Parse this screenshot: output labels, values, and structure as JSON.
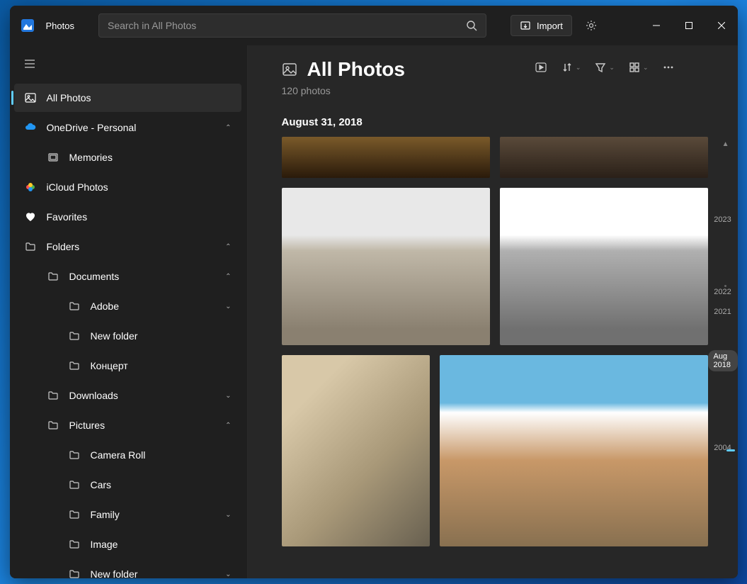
{
  "app": {
    "title": "Photos"
  },
  "search": {
    "placeholder": "Search in All Photos"
  },
  "titlebar": {
    "import_label": "Import"
  },
  "sidebar": {
    "items": [
      {
        "label": "All Photos",
        "icon": "image-icon",
        "active": true
      },
      {
        "label": "OneDrive - Personal",
        "icon": "cloud-icon",
        "expandable": "up"
      },
      {
        "label": "Memories",
        "icon": "memories-icon",
        "indent": 1
      },
      {
        "label": "iCloud Photos",
        "icon": "icloud-icon"
      },
      {
        "label": "Favorites",
        "icon": "heart-icon"
      },
      {
        "label": "Folders",
        "icon": "folder-icon",
        "expandable": "up"
      },
      {
        "label": "Documents",
        "icon": "folder-icon",
        "indent": 1,
        "expandable": "up"
      },
      {
        "label": "Adobe",
        "icon": "folder-icon",
        "indent": 2,
        "expandable": "down"
      },
      {
        "label": "New folder",
        "icon": "folder-icon",
        "indent": 2
      },
      {
        "label": "Концерт",
        "icon": "folder-icon",
        "indent": 2
      },
      {
        "label": "Downloads",
        "icon": "folder-icon",
        "indent": 1,
        "expandable": "down"
      },
      {
        "label": "Pictures",
        "icon": "folder-icon",
        "indent": 1,
        "expandable": "up"
      },
      {
        "label": "Camera Roll",
        "icon": "folder-icon",
        "indent": 2
      },
      {
        "label": "Cars",
        "icon": "folder-icon",
        "indent": 2
      },
      {
        "label": "Family",
        "icon": "folder-icon",
        "indent": 2,
        "expandable": "down"
      },
      {
        "label": "Image",
        "icon": "folder-icon",
        "indent": 2
      },
      {
        "label": "New folder",
        "icon": "folder-icon",
        "indent": 2,
        "expandable": "down"
      }
    ]
  },
  "main": {
    "title": "All Photos",
    "count": "120 photos",
    "date_heading": "August 31, 2018"
  },
  "timeline": {
    "years": [
      "2023",
      "2022",
      "2021"
    ],
    "current": "Aug 2018",
    "bottom": "2004"
  }
}
